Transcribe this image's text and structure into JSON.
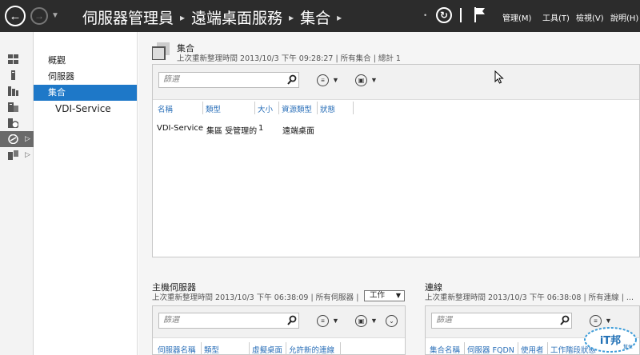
{
  "titlebar": {
    "breadcrumbs": [
      "伺服器管理員",
      "遠端桌面服務",
      "集合"
    ],
    "menus": [
      "管理(M)",
      "工具(T)",
      "檢視(V)",
      "說明(H)"
    ],
    "icons": [
      "back-arrow-icon",
      "forward-arrow-icon",
      "refresh-icon",
      "flag-icon"
    ]
  },
  "rail": {
    "items": [
      "dashboard-icon",
      "local-server-icon",
      "all-servers-icon",
      "file-services-icon",
      "ad-icon",
      "remote-desktop-icon",
      "more-roles-icon"
    ]
  },
  "subnav": {
    "items": [
      {
        "label": "概觀"
      },
      {
        "label": "伺服器"
      },
      {
        "label": "集合"
      },
      {
        "label": "VDI-Service"
      }
    ]
  },
  "collections": {
    "title": "集合",
    "subtitle": "上次重新整理時間 2013/10/3 下午 09:28:27 | 所有集合 | 總計 1",
    "filter_placeholder": "篩選",
    "columns": [
      "名稱",
      "類型",
      "大小",
      "資源類型",
      "狀態"
    ],
    "rows": [
      {
        "name": "VDI-Service",
        "type": "集區 受管理的",
        "size": "1",
        "resource": "遠端桌面",
        "status": ""
      }
    ]
  },
  "host_servers": {
    "title": "主機伺服器",
    "subtitle": "上次重新整理時間 2013/10/3 下午 06:38:09 | 所有伺服器 | ...",
    "task_button": "工作",
    "filter_placeholder": "篩選",
    "columns": [
      "伺服器名稱",
      "類型",
      "虛擬桌面",
      "允許新的連線"
    ]
  },
  "connections": {
    "title": "連線",
    "subtitle": "上次重新整理時間 2013/10/3 下午 06:38:08 | 所有連線 | ...",
    "filter_placeholder": "篩選",
    "columns": [
      "集合名稱",
      "伺服器 FQDN",
      "使用者",
      "工作階段狀態"
    ]
  },
  "watermark": "iT邦幫忙",
  "colors": {
    "titlebar": "#2c2c2c",
    "selected": "#1e78c8",
    "column_header": "#2a6fb8"
  }
}
